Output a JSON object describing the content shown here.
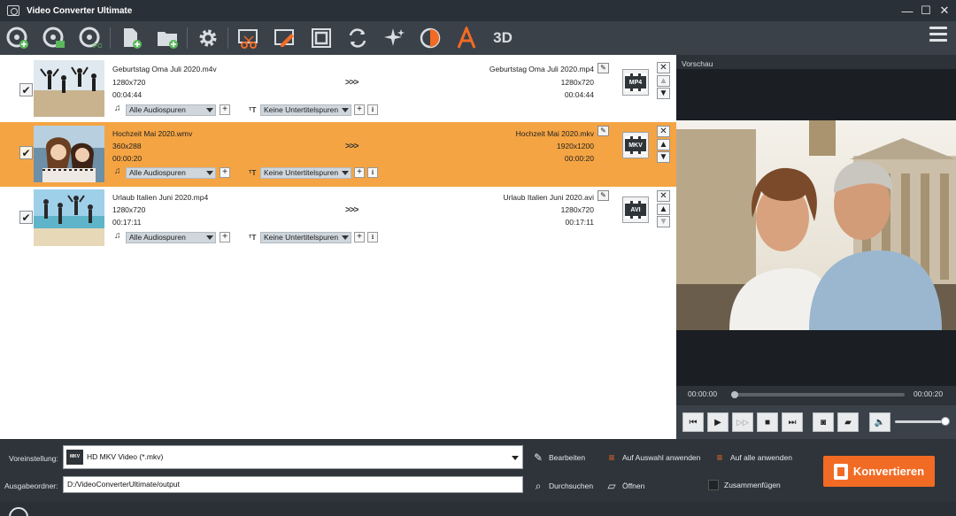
{
  "window": {
    "title": "Video Converter Ultimate"
  },
  "toolbar": {
    "icons": [
      "load-disc-icon",
      "load-dvd-folder-icon",
      "load-ifo-icon",
      "add-file-icon",
      "add-folder-icon",
      "preferences-gear-icon",
      "clip-scissors-icon",
      "edit-video-icon",
      "crop-icon",
      "rotate-icon",
      "enhance-sparkle-icon",
      "effect-icon",
      "watermark-icon",
      "3d-icon"
    ],
    "label_3d": "3D"
  },
  "files": [
    {
      "source_name": "Geburtstag Oma Juli 2020.m4v",
      "source_resolution": "1280x720",
      "source_duration": "00:04:44",
      "target_name": "Geburtstag Oma Juli 2020.mp4",
      "target_resolution": "1280x720",
      "target_duration": "00:04:44",
      "format_badge": "MP4",
      "audio": "Alle Audiospuren",
      "subtitle": "Keine Untertitelspuren",
      "arrows": ">>>",
      "checked": "✔",
      "selected": false
    },
    {
      "source_name": "Hochzeit Mai 2020.wmv",
      "source_resolution": "360x288",
      "source_duration": "00:00:20",
      "target_name": "Hochzeit Mai 2020.mkv",
      "target_resolution": "1920x1200",
      "target_duration": "00:00:20",
      "format_badge": "MKV",
      "audio": "Alle Audiospuren",
      "subtitle": "Keine Untertitelspuren",
      "arrows": ">>>",
      "checked": "✔",
      "selected": true
    },
    {
      "source_name": "Urlaub Italien  Juni 2020.mp4",
      "source_resolution": "1280x720",
      "source_duration": "00:17:11",
      "target_name": "Urlaub Italien  Juni 2020.avi",
      "target_resolution": "1280x720",
      "target_duration": "00:17:11",
      "format_badge": "AVI",
      "audio": "Alle Audiospuren",
      "subtitle": "Keine Untertitelspuren",
      "arrows": ">>>",
      "checked": "✔",
      "selected": false
    }
  ],
  "preview": {
    "label": "Vorschau",
    "time_current": "00:00:00",
    "time_total": "00:00:20",
    "progress": 0.0,
    "volume": 0.95
  },
  "bottom": {
    "preset_label": "Voreinstellung:",
    "preset_value": "HD MKV Video (*.mkv)",
    "preset_badge": "MKV",
    "output_label": "Ausgabeordner:",
    "output_value": "D:/VideoConverterUltimate/output",
    "edit_label": "Bearbeiten",
    "apply_selection_label": "Auf Auswahl  anwenden",
    "apply_all_label": "Auf alle anwenden",
    "browse_label": "Durchsuchen",
    "open_label": "Öffnen",
    "merge_label": "Zusammenfügen",
    "convert_label": "Konvertieren"
  },
  "colors": {
    "selection": "#f5a443",
    "convert_button": "#f26b24",
    "toolbar": "#3a4149",
    "titlebar": "#2a3037"
  }
}
